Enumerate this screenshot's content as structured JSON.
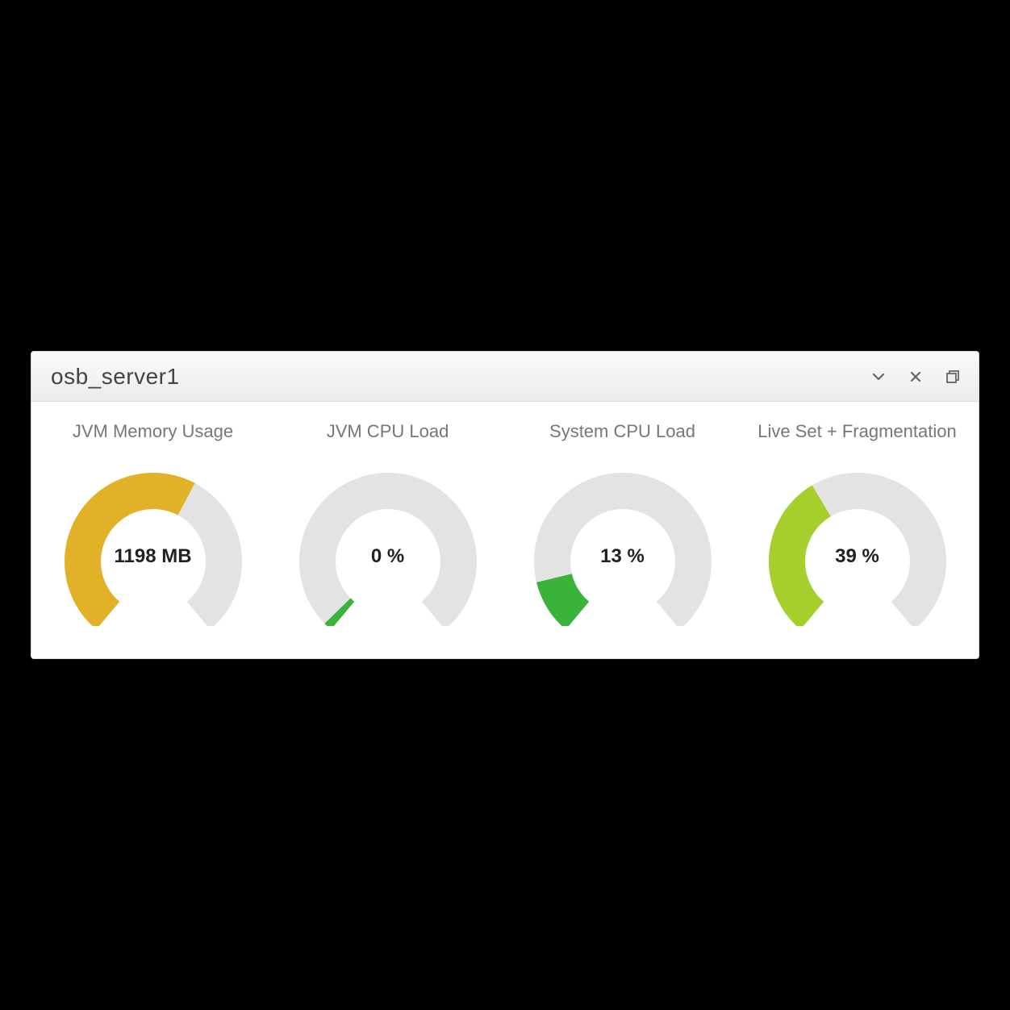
{
  "panel": {
    "title": "osb_server1"
  },
  "colors": {
    "track": "#e3e3e3",
    "amber": "#e1b228",
    "green": "#3bb33b",
    "lime": "#a5cf2a"
  },
  "chart_data": {
    "type": "gauge",
    "start_angle_deg": -230,
    "end_angle_deg": 50,
    "gauges": [
      {
        "id": "jvm-memory",
        "title": "JVM Memory Usage",
        "display": "1198 MB",
        "value": 1198,
        "max": 2000,
        "fraction": 0.6,
        "color_key": "amber"
      },
      {
        "id": "jvm-cpu",
        "title": "JVM CPU Load",
        "display": "0 %",
        "value": 0,
        "max": 100,
        "fraction": 0.02,
        "color_key": "green"
      },
      {
        "id": "system-cpu",
        "title": "System CPU Load",
        "display": "13 %",
        "value": 13,
        "max": 100,
        "fraction": 0.13,
        "color_key": "green"
      },
      {
        "id": "live-frag",
        "title": "Live Set + Fragmentation",
        "display": "39 %",
        "value": 39,
        "max": 100,
        "fraction": 0.39,
        "color_key": "lime"
      }
    ]
  }
}
